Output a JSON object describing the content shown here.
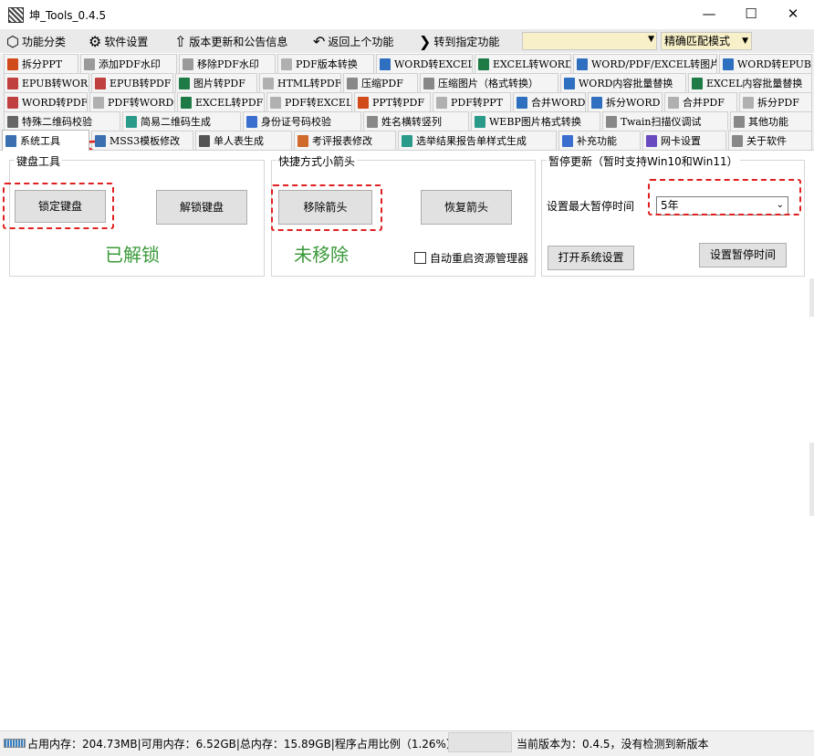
{
  "window": {
    "title": "坤_Tools_0.4.5",
    "minimize_glyph": "—",
    "maximize_glyph": "☐",
    "close_glyph": "✕"
  },
  "toolbar": {
    "items": [
      {
        "label": "功能分类",
        "icon": "cube-icon",
        "glyph": "⬡"
      },
      {
        "label": "软件设置",
        "icon": "gear-icon",
        "glyph": "⚙"
      },
      {
        "label": "版本更新和公告信息",
        "icon": "arrow-up-circle-icon",
        "glyph": "⇧"
      },
      {
        "label": "返回上个功能",
        "icon": "undo-arrow-icon",
        "glyph": "↶"
      },
      {
        "label": "转到指定功能",
        "icon": "arrow-right-circle-icon",
        "glyph": "❯"
      }
    ],
    "search_value": "",
    "match_mode": "精确匹配模式"
  },
  "tabs": {
    "rows": [
      [
        {
          "label": "拆分PPT",
          "color": "#d04a1a"
        },
        {
          "label": "添加PDF水印",
          "color": "#9a9a9a"
        },
        {
          "label": "移除PDF水印",
          "color": "#9a9a9a"
        },
        {
          "label": "PDF版本转换",
          "color": "#b0b0b0"
        },
        {
          "label": "WORD转EXCEL",
          "color": "#2f6fbf"
        },
        {
          "label": "EXCEL转WORD",
          "color": "#1e7b45"
        },
        {
          "label": "WORD/PDF/EXCEL转图片",
          "color": "#2f6fbf"
        },
        {
          "label": "WORD转EPUB",
          "color": "#2f6fbf"
        }
      ],
      [
        {
          "label": "EPUB转WORD",
          "color": "#c04040"
        },
        {
          "label": "EPUB转PDF",
          "color": "#c04040"
        },
        {
          "label": "图片转PDF",
          "color": "#1e7b45"
        },
        {
          "label": "HTML转PDF",
          "color": "#b0b0b0"
        },
        {
          "label": "压缩PDF",
          "color": "#888888"
        },
        {
          "label": "压缩图片（格式转换）",
          "color": "#888888"
        },
        {
          "label": "WORD内容批量替换",
          "color": "#2f6fbf"
        },
        {
          "label": "EXCEL内容批量替换",
          "color": "#1e7b45"
        }
      ],
      [
        {
          "label": "WORD转PDF",
          "color": "#c04040"
        },
        {
          "label": "PDF转WORD",
          "color": "#b0b0b0"
        },
        {
          "label": "EXCEL转PDF",
          "color": "#1e7b45"
        },
        {
          "label": "PDF转EXCEL",
          "color": "#b0b0b0"
        },
        {
          "label": "PPT转PDF",
          "color": "#d04a1a"
        },
        {
          "label": "PDF转PPT",
          "color": "#b0b0b0"
        },
        {
          "label": "合并WORD",
          "color": "#2f6fbf"
        },
        {
          "label": "拆分WORD",
          "color": "#2f6fbf"
        },
        {
          "label": "合并PDF",
          "color": "#b0b0b0"
        },
        {
          "label": "拆分PDF",
          "color": "#b0b0b0"
        }
      ],
      [
        {
          "label": "特殊二维码校验",
          "color": "#666666"
        },
        {
          "label": "简易二维码生成",
          "color": "#2a9a8a"
        },
        {
          "label": "身份证号码校验",
          "color": "#3a6fcf"
        },
        {
          "label": "姓名横转竖列",
          "color": "#888888"
        },
        {
          "label": "WEBP图片格式转换",
          "color": "#2a9a8a"
        },
        {
          "label": "Twain扫描仪调试",
          "color": "#888888"
        },
        {
          "label": "其他功能",
          "color": "#888888"
        }
      ],
      [
        {
          "label": "系统工具",
          "color": "#3a6fb0"
        },
        {
          "label": "MSS3模板修改",
          "color": "#3a6fb0"
        },
        {
          "label": "单人表生成",
          "color": "#555555"
        },
        {
          "label": "考评报表修改",
          "color": "#d06a2a"
        },
        {
          "label": "选举结果报告单样式生成",
          "color": "#2a9a8a"
        },
        {
          "label": "补充功能",
          "color": "#3a6fcf"
        },
        {
          "label": "网卡设置",
          "color": "#6a4abf"
        },
        {
          "label": "关于软件",
          "color": "#888888"
        }
      ]
    ]
  },
  "keyboard_group": {
    "title": "键盘工具",
    "lock_label": "锁定键盘",
    "unlock_label": "解锁键盘",
    "status": "已解锁"
  },
  "arrow_group": {
    "title": "快捷方式小箭头",
    "remove_label": "移除箭头",
    "restore_label": "恢复箭头",
    "status": "未移除",
    "restart_checkbox_label": "自动重启资源管理器",
    "restart_checked": false
  },
  "pause_group": {
    "title": "暂停更新（暂时支持Win10和Win11）",
    "max_pause_label": "设置最大暂停时间",
    "max_pause_value": "5年",
    "open_settings_label": "打开系统设置",
    "set_pause_label": "设置暂停时间"
  },
  "status": {
    "memory_text": "占用内存：204.73MB|可用内存：6.52GB|总内存：15.89GB|程序占用比例（1.26%）",
    "version_text": "当前版本为：0.4.5，没有检测到新版本"
  },
  "colors": {
    "accent_red": "#e02020",
    "status_green": "#3a9a3a",
    "toolbar_bg": "#eaeaea"
  }
}
